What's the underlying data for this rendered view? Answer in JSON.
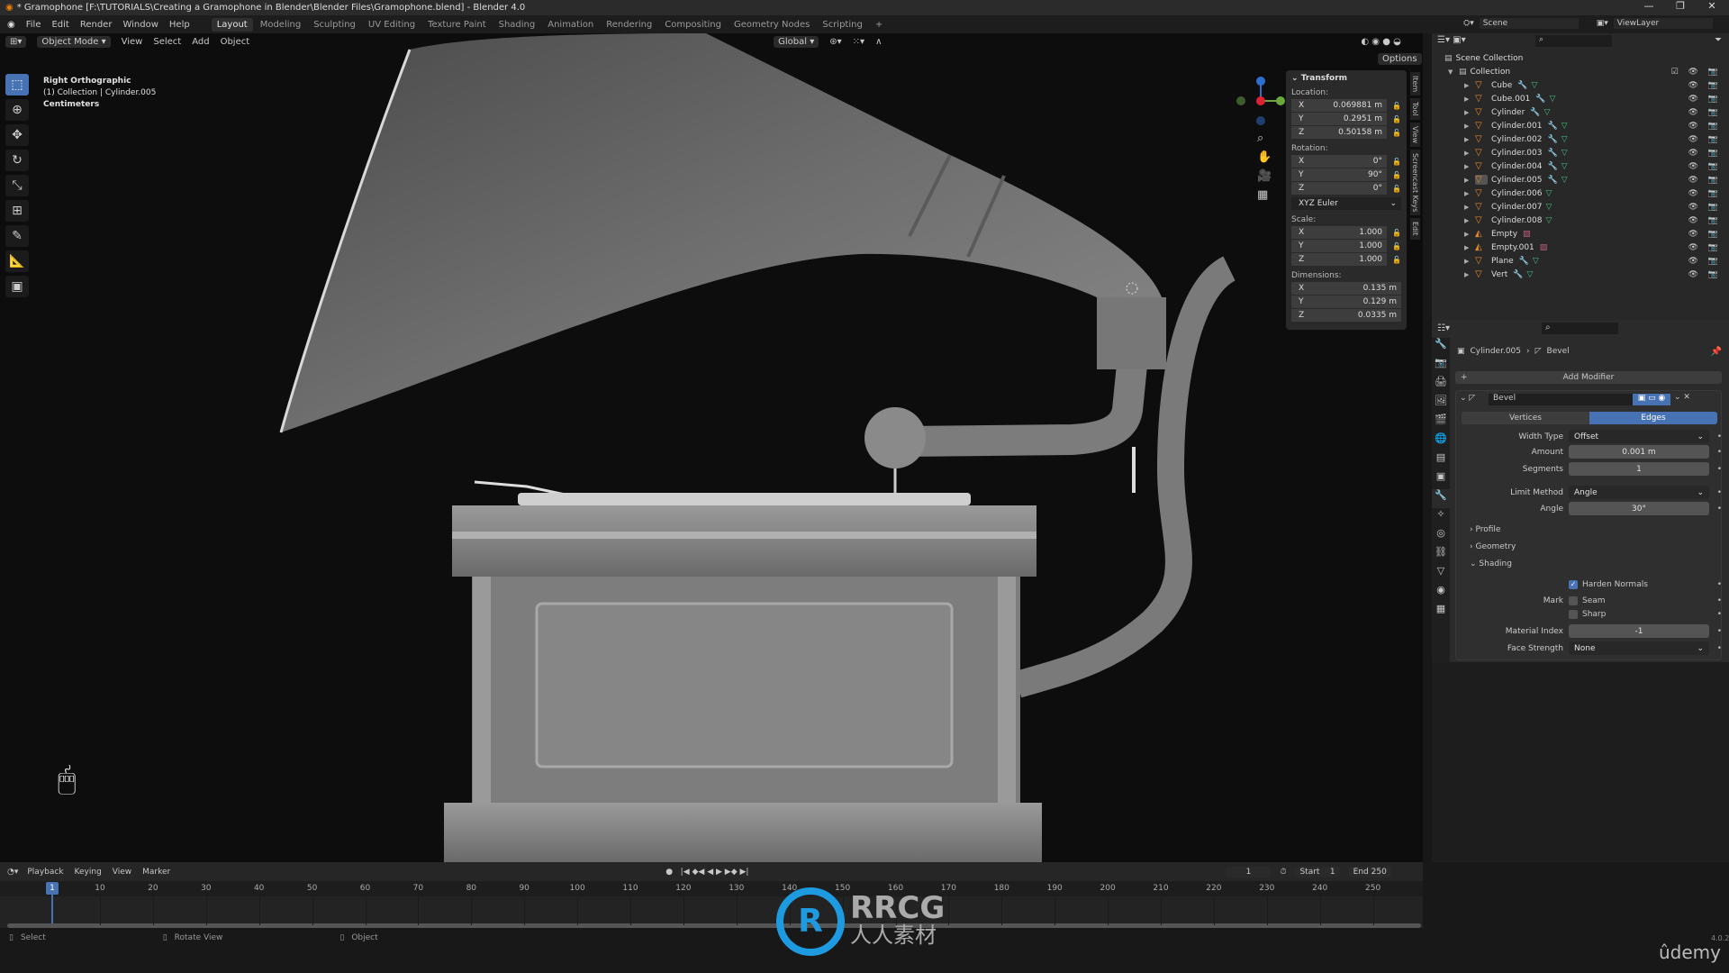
{
  "window": {
    "title": "* Gramophone [F:\\TUTORIALS\\Creating a Gramophone in Blender\\Blender Files\\Gramophone.blend] - Blender 4.0",
    "controls": [
      "—",
      "❐",
      "✕"
    ]
  },
  "menu": [
    "File",
    "Edit",
    "Render",
    "Window",
    "Help"
  ],
  "workspaces": [
    {
      "label": "Layout",
      "active": true
    },
    {
      "label": "Modeling"
    },
    {
      "label": "Sculpting"
    },
    {
      "label": "UV Editing"
    },
    {
      "label": "Texture Paint"
    },
    {
      "label": "Shading"
    },
    {
      "label": "Animation"
    },
    {
      "label": "Rendering"
    },
    {
      "label": "Compositing"
    },
    {
      "label": "Geometry Nodes"
    },
    {
      "label": "Scripting"
    },
    {
      "label": "+"
    }
  ],
  "viewport_header": {
    "mode": "Object Mode",
    "menus": [
      "View",
      "Select",
      "Add",
      "Object"
    ],
    "orientation": "Global",
    "options": "Options"
  },
  "overlay": {
    "view": "Right Orthographic",
    "object": "(1) Collection | Cylinder.005",
    "units": "Centimeters"
  },
  "tools": [
    "select-box",
    "cursor",
    "move",
    "rotate",
    "scale",
    "transform",
    "annotate",
    "measure",
    "add-cube"
  ],
  "transform": {
    "title": "Transform",
    "location_label": "Location:",
    "location": [
      {
        "axis": "X",
        "value": "0.069881 m"
      },
      {
        "axis": "Y",
        "value": "0.2951 m"
      },
      {
        "axis": "Z",
        "value": "0.50158 m"
      }
    ],
    "rotation_label": "Rotation:",
    "rotation": [
      {
        "axis": "X",
        "value": "0°"
      },
      {
        "axis": "Y",
        "value": "90°"
      },
      {
        "axis": "Z",
        "value": "0°"
      }
    ],
    "rotation_mode": "XYZ Euler",
    "scale_label": "Scale:",
    "scale": [
      {
        "axis": "X",
        "value": "1.000"
      },
      {
        "axis": "Y",
        "value": "1.000"
      },
      {
        "axis": "Z",
        "value": "1.000"
      }
    ],
    "dimensions_label": "Dimensions:",
    "dimensions": [
      {
        "axis": "X",
        "value": "0.135 m"
      },
      {
        "axis": "Y",
        "value": "0.129 m"
      },
      {
        "axis": "Z",
        "value": "0.0335 m"
      }
    ]
  },
  "side_tabs": [
    "Item",
    "Tool",
    "View",
    "Screencast Keys",
    "Edit"
  ],
  "topbar_right": {
    "scene": "Scene",
    "view_layer": "ViewLayer"
  },
  "outliner": {
    "scene_collection": "Scene Collection",
    "collection": "Collection",
    "items": [
      {
        "name": "Cube",
        "type": "mesh",
        "modifier": true
      },
      {
        "name": "Cube.001",
        "type": "mesh",
        "modifier": true
      },
      {
        "name": "Cylinder",
        "type": "mesh",
        "modifier": true
      },
      {
        "name": "Cylinder.001",
        "type": "mesh",
        "modifier": true
      },
      {
        "name": "Cylinder.002",
        "type": "mesh",
        "modifier": true
      },
      {
        "name": "Cylinder.003",
        "type": "mesh",
        "modifier": true
      },
      {
        "name": "Cylinder.004",
        "type": "mesh",
        "modifier": true
      },
      {
        "name": "Cylinder.005",
        "type": "mesh",
        "modifier": true,
        "active": true
      },
      {
        "name": "Cylinder.006",
        "type": "mesh",
        "modifier": false
      },
      {
        "name": "Cylinder.007",
        "type": "mesh",
        "modifier": false
      },
      {
        "name": "Cylinder.008",
        "type": "mesh",
        "modifier": false
      },
      {
        "name": "Empty",
        "type": "empty",
        "modifier": false
      },
      {
        "name": "Empty.001",
        "type": "empty",
        "modifier": false
      },
      {
        "name": "Plane",
        "type": "mesh",
        "modifier": true
      },
      {
        "name": "Vert",
        "type": "mesh",
        "modifier": true
      }
    ]
  },
  "properties": {
    "breadcrumb_object": "Cylinder.005",
    "breadcrumb_modifier": "Bevel",
    "add_modifier": "Add Modifier",
    "modifier_name": "Bevel",
    "affect_tabs": [
      {
        "label": "Vertices",
        "active": false
      },
      {
        "label": "Edges",
        "active": true
      }
    ],
    "width_type_label": "Width Type",
    "width_type": "Offset",
    "amount_label": "Amount",
    "amount": "0.001 m",
    "segments_label": "Segments",
    "segments": "1",
    "limit_method_label": "Limit Method",
    "limit_method": "Angle",
    "angle_label": "Angle",
    "angle": "30°",
    "panels": [
      "Profile",
      "Geometry",
      "Shading"
    ],
    "harden_normals": {
      "label": "Harden Normals",
      "checked": true
    },
    "mark_label": "Mark",
    "seam": {
      "label": "Seam",
      "checked": false
    },
    "sharp": {
      "label": "Sharp",
      "checked": false
    },
    "material_index_label": "Material Index",
    "material_index": "-1",
    "face_strength_label": "Face Strength",
    "face_strength": "None"
  },
  "timeline": {
    "menus": [
      "Playback",
      "Keying",
      "View",
      "Marker"
    ],
    "current_frame": "1",
    "start_label": "Start",
    "start": "1",
    "end_label": "End",
    "end": "250",
    "ticks": [
      "10",
      "20",
      "30",
      "40",
      "50",
      "60",
      "70",
      "80",
      "90",
      "100",
      "110",
      "120",
      "130",
      "140",
      "150",
      "160",
      "170",
      "180",
      "190",
      "200",
      "210",
      "220",
      "230",
      "240",
      "250"
    ]
  },
  "statusbar": {
    "select": "Select",
    "rotate": "Rotate View",
    "object": "Object",
    "version": "4.0.2"
  },
  "watermark": {
    "brand": "RRCG",
    "sub": "人人素材",
    "udemy": "ûdemy"
  },
  "colors": {
    "accent": "#4772b3",
    "object": "#e8892c",
    "mesh": "#3fbf7f",
    "modifier": "#7d8fd6",
    "viewport_bg": "#0d0d0d"
  }
}
